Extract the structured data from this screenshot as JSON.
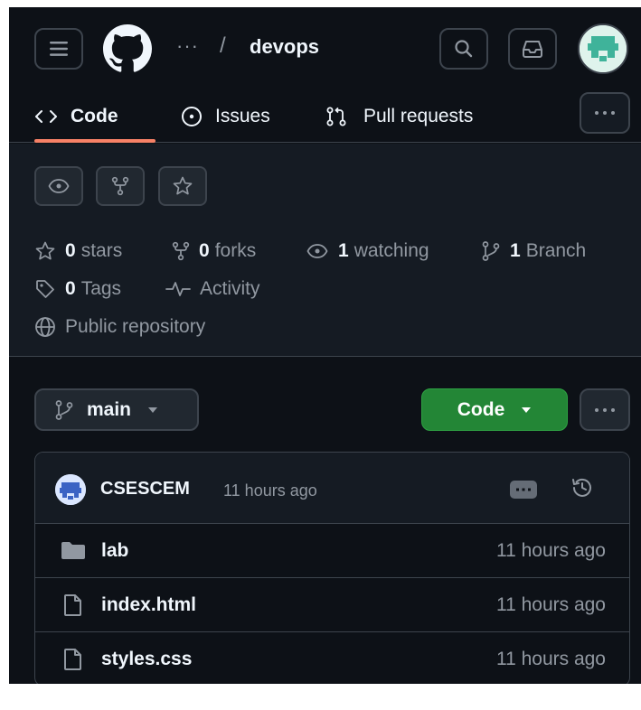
{
  "header": {
    "breadcrumb_ellipsis": "···",
    "separator": "/",
    "repo_name": "devops"
  },
  "tabs": [
    {
      "label": "Code",
      "icon": "code-icon",
      "selected": true
    },
    {
      "label": "Issues",
      "icon": "issue-opened-icon"
    },
    {
      "label": "Pull requests",
      "icon": "git-pull-request-icon"
    }
  ],
  "repo_stats": {
    "stars_count": "0",
    "stars_label": "stars",
    "forks_count": "0",
    "forks_label": "forks",
    "watching_count": "1",
    "watching_label": "watching",
    "branch_count": "1",
    "branch_label": "Branch",
    "tags_count": "0",
    "tags_label": "Tags",
    "activity_label": "Activity",
    "visibility_label": "Public repository"
  },
  "branch": {
    "label": "main"
  },
  "code_button": {
    "label": "Code"
  },
  "latest_commit": {
    "author": "CSESCEM",
    "time": "11 hours ago"
  },
  "files": [
    {
      "name": "lab",
      "type": "folder",
      "time": "11 hours ago"
    },
    {
      "name": "index.html",
      "type": "file",
      "time": "11 hours ago"
    },
    {
      "name": "styles.css",
      "type": "file",
      "time": "11 hours ago"
    }
  ],
  "colors": {
    "background": "#0d1117",
    "panel": "#151b23",
    "border": "#3d444d",
    "accent_green": "#238636",
    "tab_underline": "#f78166",
    "muted_text": "#9198a1"
  }
}
